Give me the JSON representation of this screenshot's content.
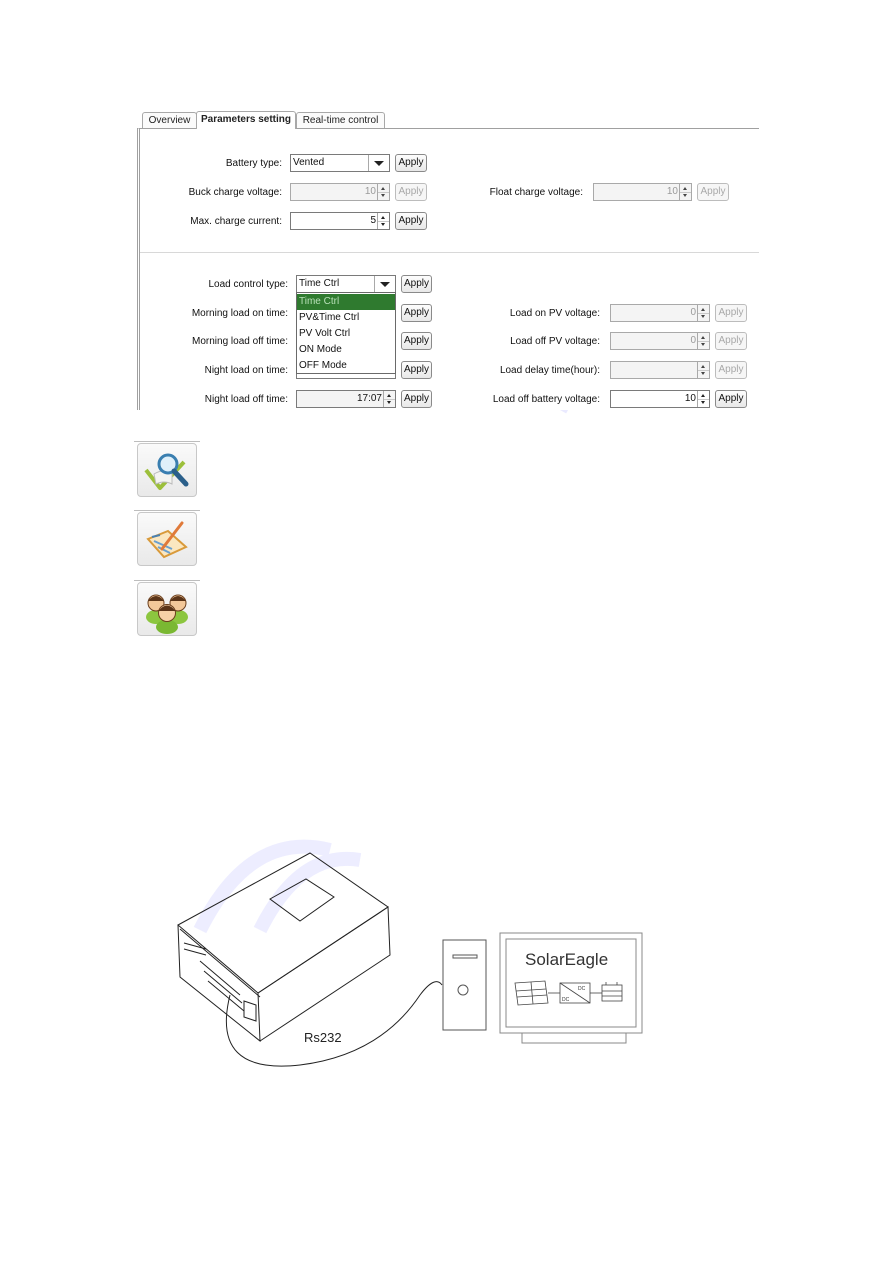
{
  "tabs": [
    {
      "label": "Overview",
      "active": false
    },
    {
      "label": "Parameters setting",
      "active": true
    },
    {
      "label": "Real-time control",
      "active": false
    }
  ],
  "charge_section": {
    "battery_type": {
      "label": "Battery type:",
      "value": "Vented",
      "apply": "Apply"
    },
    "buck_charge_voltage": {
      "label": "Buck charge voltage:",
      "value": "10",
      "apply": "Apply",
      "disabled": true
    },
    "float_charge_voltage": {
      "label": "Float charge voltage:",
      "value": "10",
      "apply": "Apply",
      "disabled": true
    },
    "max_charge_current": {
      "label": "Max. charge current:",
      "value": "5",
      "apply": "Apply"
    }
  },
  "load_section": {
    "load_control_type": {
      "label": "Load control type:",
      "value": "Time Ctrl",
      "apply": "Apply",
      "options": [
        "Time Ctrl",
        "PV&Time Ctrl",
        "PV Volt Ctrl",
        "ON Mode",
        "OFF Mode"
      ],
      "selected_index": 0
    },
    "morning_load_on_time": {
      "label": "Morning load on time:",
      "apply": "Apply"
    },
    "morning_load_off_time": {
      "label": "Morning load off time:",
      "apply": "Apply"
    },
    "night_load_on_time": {
      "label": "Night load on time:",
      "apply": "Apply"
    },
    "night_load_off_time": {
      "label": "Night load off time:",
      "value": "17:07",
      "apply": "Apply"
    },
    "load_on_pv_voltage": {
      "label": "Load on PV voltage:",
      "value": "0",
      "apply": "Apply",
      "disabled": true
    },
    "load_off_pv_voltage": {
      "label": "Load off PV voltage:",
      "value": "0",
      "apply": "Apply",
      "disabled": true
    },
    "load_delay_time": {
      "label": "Load delay time(hour):",
      "value": "",
      "apply": "Apply",
      "disabled": true
    },
    "load_off_battery_voltage": {
      "label": "Load off battery voltage:",
      "value": "10",
      "apply": "Apply"
    }
  },
  "icons": [
    {
      "name": "search-check-icon"
    },
    {
      "name": "edit-clipboard-icon"
    },
    {
      "name": "users-group-icon"
    }
  ],
  "diagram": {
    "cable_label": "Rs232",
    "screen_title": "SolarEagle",
    "dc_in": "DC",
    "dc_out": "DC"
  },
  "colors": {
    "selected_option_bg": "#2f7a2f",
    "watermark": "#c8c8ff"
  }
}
